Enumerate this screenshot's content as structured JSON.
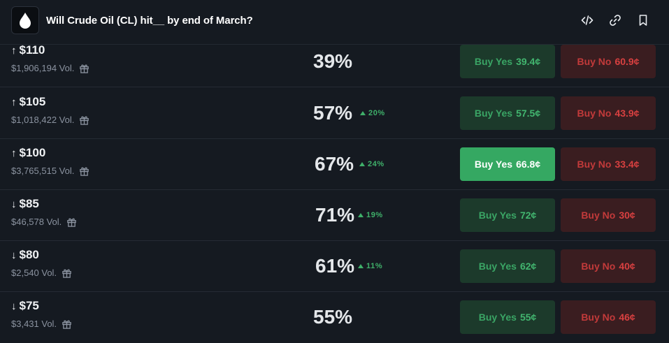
{
  "header": {
    "title": "Will Crude Oil (CL) hit__ by end of March?",
    "icons": [
      "water-drop-icon",
      "embed-code-icon",
      "link-icon",
      "bookmark-icon"
    ]
  },
  "colors": {
    "background": "#151a21",
    "yes_bg": "#1c3a2b",
    "yes_active_bg": "#35a862",
    "yes_text": "#3aa565",
    "no_bg": "#3a1d20",
    "no_text": "#c23a3a",
    "positive": "#3fb06a"
  },
  "rows": [
    {
      "direction": "up",
      "arrow": "↑",
      "threshold": "$110",
      "volume": "$1,906,194 Vol.",
      "percent": "39%",
      "delta": "",
      "yes_label": "Buy Yes",
      "yes_price": "39.4¢",
      "no_label": "Buy No",
      "no_price": "60.9¢",
      "selected": false
    },
    {
      "direction": "up",
      "arrow": "↑",
      "threshold": "$105",
      "volume": "$1,018,422 Vol.",
      "percent": "57%",
      "delta": "20%",
      "yes_label": "Buy Yes",
      "yes_price": "57.5¢",
      "no_label": "Buy No",
      "no_price": "43.9¢",
      "selected": false
    },
    {
      "direction": "up",
      "arrow": "↑",
      "threshold": "$100",
      "volume": "$3,765,515 Vol.",
      "percent": "67%",
      "delta": "24%",
      "yes_label": "Buy Yes",
      "yes_price": "66.8¢",
      "no_label": "Buy No",
      "no_price": "33.4¢",
      "selected": true
    },
    {
      "direction": "down",
      "arrow": "↓",
      "threshold": "$85",
      "volume": "$46,578 Vol.",
      "percent": "71%",
      "delta": "19%",
      "yes_label": "Buy Yes",
      "yes_price": "72¢",
      "no_label": "Buy No",
      "no_price": "30¢",
      "selected": false
    },
    {
      "direction": "down",
      "arrow": "↓",
      "threshold": "$80",
      "volume": "$2,540 Vol.",
      "percent": "61%",
      "delta": "11%",
      "yes_label": "Buy Yes",
      "yes_price": "62¢",
      "no_label": "Buy No",
      "no_price": "40¢",
      "selected": false
    },
    {
      "direction": "down",
      "arrow": "↓",
      "threshold": "$75",
      "volume": "$3,431 Vol.",
      "percent": "55%",
      "delta": "",
      "yes_label": "Buy Yes",
      "yes_price": "55¢",
      "no_label": "Buy No",
      "no_price": "46¢",
      "selected": false
    }
  ]
}
